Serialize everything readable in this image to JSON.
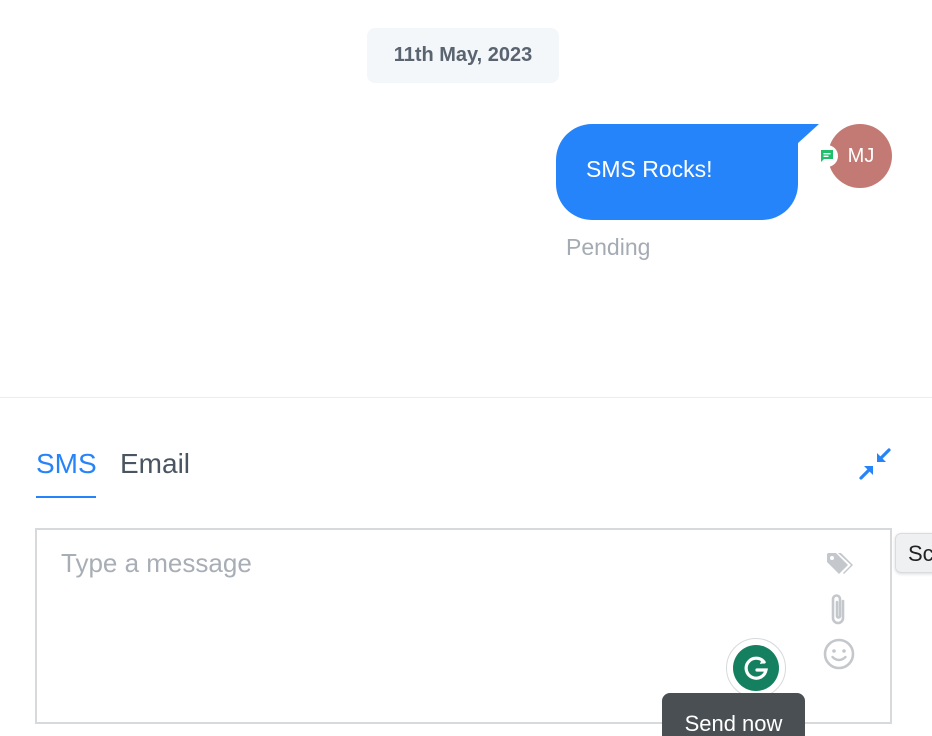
{
  "conversation": {
    "date_label": "11th May, 2023",
    "messages": [
      {
        "text": "SMS Rocks!",
        "status": "Pending",
        "sender_initials": "MJ",
        "channel_icon": "sms-icon"
      }
    ]
  },
  "composer": {
    "tabs": [
      {
        "label": "SMS",
        "active": true
      },
      {
        "label": "Email",
        "active": false
      }
    ],
    "placeholder": "Type a message",
    "value": "",
    "icons": [
      "collapse-icon",
      "tag-icon",
      "paperclip-icon",
      "smiley-icon",
      "grammarly-icon"
    ],
    "send_tooltip": "Send now"
  },
  "side_tab": {
    "label": "Sc"
  },
  "colors": {
    "accent": "#2684fa",
    "avatar": "#c47a74",
    "sms_badge": "#1fbf6b",
    "grammarly": "#15805f"
  }
}
